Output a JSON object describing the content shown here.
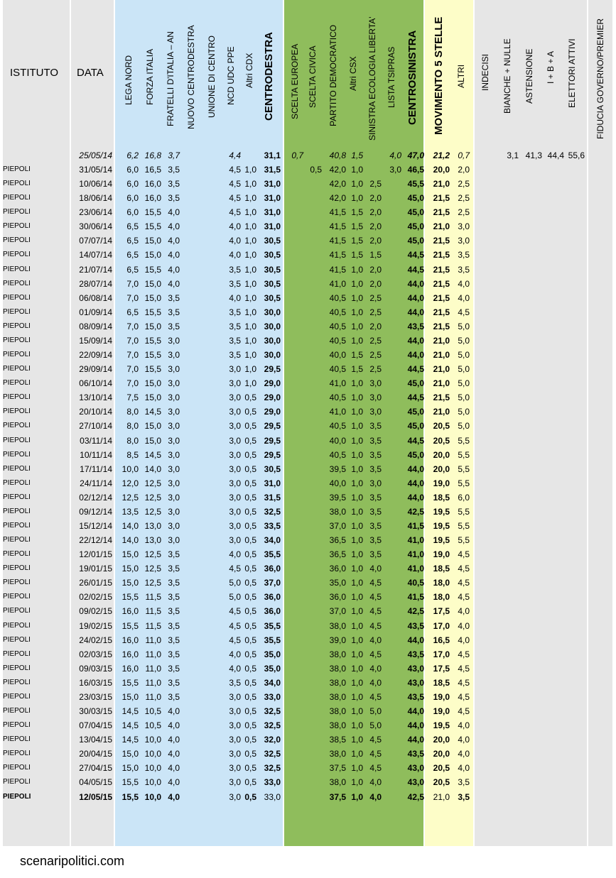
{
  "headers": {
    "istituto": "ISTITUTO",
    "data": "DATA",
    "lega_nord": "LEGA NORD",
    "forza_italia": "FORZA ITALIA",
    "fratelli_italia": "FRATELLI D'ITALIA – AN",
    "nuovo_cdx": "NUOVO  CENTRODESTRA",
    "unione_centro": "UNIONE DI CENTRO",
    "ncd_udc": "NCD UDC PPE",
    "altri_cdx": "Altri CDX",
    "centrodestra": "CENTRODESTRA",
    "scelta_europea": "SCELTA EUROPEA",
    "scelta_civica": "SCELTA CIVICA",
    "pd": "PARTITO DEMOCRATICO",
    "altri_csx": "Altri CSX",
    "sel": "SINISTRA ECOLOGIA LIBERTA'",
    "tsipras": "LISTA TSIPRAS",
    "centrosinistra": "CENTROSINISTRA",
    "m5s": "MOVIMENTO 5 STELLE",
    "altri": "ALTRI",
    "indecisi": "INDECISI",
    "bianche": "BIANCHE + NULLE",
    "astensione": "ASTENSIONE",
    "ibia": "I + B + A",
    "elettori": "ELETTORI ATTIVI",
    "fiducia": "FIDUCIA GOVERNO/PREMIER"
  },
  "colors": {
    "gray": "#e6e6e6",
    "blue": "#cbe5f7",
    "green": "#8fbd5c",
    "yellow": "#fdfdc8",
    "white": "#ffffff"
  },
  "first_row": {
    "data": "25/05/14",
    "ln": "6,2",
    "fi": "16,8",
    "fdi": "3,7",
    "ncd": "4,4",
    "cdx": "31,1",
    "se": "0,7",
    "pd": "40,8",
    "acsx": "1,5",
    "tsi": "4,0",
    "csx": "47,0",
    "m5s": "21,2",
    "altri": "0,7",
    "bian": "3,1",
    "ast": "41,3",
    "iba": "44,4",
    "el": "55,6"
  },
  "rows": [
    {
      "ist": "PIEPOLI",
      "data": "31/05/14",
      "ln": "6,0",
      "fi": "16,5",
      "fdi": "3,5",
      "ncd": "4,5",
      "acdx": "1,0",
      "cdx": "31,5",
      "sc": "0,5",
      "pd": "42,0",
      "acsx": "1,0",
      "sel": "",
      "tsi": "3,0",
      "csx": "46,5",
      "m5s": "20,0",
      "altri": "2,0"
    },
    {
      "ist": "PIEPOLI",
      "data": "10/06/14",
      "ln": "6,0",
      "fi": "16,0",
      "fdi": "3,5",
      "ncd": "4,5",
      "acdx": "1,0",
      "cdx": "31,0",
      "pd": "42,0",
      "acsx": "1,0",
      "sel": "2,5",
      "csx": "45,5",
      "m5s": "21,0",
      "altri": "2,5"
    },
    {
      "ist": "PIEPOLI",
      "data": "18/06/14",
      "ln": "6,0",
      "fi": "16,0",
      "fdi": "3,5",
      "ncd": "4,5",
      "acdx": "1,0",
      "cdx": "31,0",
      "pd": "42,0",
      "acsx": "1,0",
      "sel": "2,0",
      "csx": "45,0",
      "m5s": "21,5",
      "altri": "2,5"
    },
    {
      "ist": "PIEPOLI",
      "data": "23/06/14",
      "ln": "6,0",
      "fi": "15,5",
      "fdi": "4,0",
      "ncd": "4,5",
      "acdx": "1,0",
      "cdx": "31,0",
      "pd": "41,5",
      "acsx": "1,5",
      "sel": "2,0",
      "csx": "45,0",
      "m5s": "21,5",
      "altri": "2,5"
    },
    {
      "ist": "PIEPOLI",
      "data": "30/06/14",
      "ln": "6,5",
      "fi": "15,5",
      "fdi": "4,0",
      "ncd": "4,0",
      "acdx": "1,0",
      "cdx": "31,0",
      "pd": "41,5",
      "acsx": "1,5",
      "sel": "2,0",
      "csx": "45,0",
      "m5s": "21,0",
      "altri": "3,0"
    },
    {
      "ist": "PIEPOLI",
      "data": "07/07/14",
      "ln": "6,5",
      "fi": "15,0",
      "fdi": "4,0",
      "ncd": "4,0",
      "acdx": "1,0",
      "cdx": "30,5",
      "pd": "41,5",
      "acsx": "1,5",
      "sel": "2,0",
      "csx": "45,0",
      "m5s": "21,5",
      "altri": "3,0"
    },
    {
      "ist": "PIEPOLI",
      "data": "14/07/14",
      "ln": "6,5",
      "fi": "15,0",
      "fdi": "4,0",
      "ncd": "4,0",
      "acdx": "1,0",
      "cdx": "30,5",
      "pd": "41,5",
      "acsx": "1,5",
      "sel": "1,5",
      "csx": "44,5",
      "m5s": "21,5",
      "altri": "3,5"
    },
    {
      "ist": "PIEPOLI",
      "data": "21/07/14",
      "ln": "6,5",
      "fi": "15,5",
      "fdi": "4,0",
      "ncd": "3,5",
      "acdx": "1,0",
      "cdx": "30,5",
      "pd": "41,5",
      "acsx": "1,0",
      "sel": "2,0",
      "csx": "44,5",
      "m5s": "21,5",
      "altri": "3,5"
    },
    {
      "ist": "PIEPOLI",
      "data": "28/07/14",
      "ln": "7,0",
      "fi": "15,0",
      "fdi": "4,0",
      "ncd": "3,5",
      "acdx": "1,0",
      "cdx": "30,5",
      "pd": "41,0",
      "acsx": "1,0",
      "sel": "2,0",
      "csx": "44,0",
      "m5s": "21,5",
      "altri": "4,0"
    },
    {
      "ist": "PIEPOLI",
      "data": "06/08/14",
      "ln": "7,0",
      "fi": "15,0",
      "fdi": "3,5",
      "ncd": "4,0",
      "acdx": "1,0",
      "cdx": "30,5",
      "pd": "40,5",
      "acsx": "1,0",
      "sel": "2,5",
      "csx": "44,0",
      "m5s": "21,5",
      "altri": "4,0"
    },
    {
      "ist": "PIEPOLI",
      "data": "01/09/14",
      "ln": "6,5",
      "fi": "15,5",
      "fdi": "3,5",
      "ncd": "3,5",
      "acdx": "1,0",
      "cdx": "30,0",
      "pd": "40,5",
      "acsx": "1,0",
      "sel": "2,5",
      "csx": "44,0",
      "m5s": "21,5",
      "altri": "4,5"
    },
    {
      "ist": "PIEPOLI",
      "data": "08/09/14",
      "ln": "7,0",
      "fi": "15,0",
      "fdi": "3,5",
      "ncd": "3,5",
      "acdx": "1,0",
      "cdx": "30,0",
      "pd": "40,5",
      "acsx": "1,0",
      "sel": "2,0",
      "csx": "43,5",
      "m5s": "21,5",
      "altri": "5,0"
    },
    {
      "ist": "PIEPOLI",
      "data": "15/09/14",
      "ln": "7,0",
      "fi": "15,5",
      "fdi": "3,0",
      "ncd": "3,5",
      "acdx": "1,0",
      "cdx": "30,0",
      "pd": "40,5",
      "acsx": "1,0",
      "sel": "2,5",
      "csx": "44,0",
      "m5s": "21,0",
      "altri": "5,0"
    },
    {
      "ist": "PIEPOLI",
      "data": "22/09/14",
      "ln": "7,0",
      "fi": "15,5",
      "fdi": "3,0",
      "ncd": "3,5",
      "acdx": "1,0",
      "cdx": "30,0",
      "pd": "40,0",
      "acsx": "1,5",
      "sel": "2,5",
      "csx": "44,0",
      "m5s": "21,0",
      "altri": "5,0"
    },
    {
      "ist": "PIEPOLI",
      "data": "29/09/14",
      "ln": "7,0",
      "fi": "15,5",
      "fdi": "3,0",
      "ncd": "3,0",
      "acdx": "1,0",
      "cdx": "29,5",
      "pd": "40,5",
      "acsx": "1,5",
      "sel": "2,5",
      "csx": "44,5",
      "m5s": "21,0",
      "altri": "5,0"
    },
    {
      "ist": "PIEPOLI",
      "data": "06/10/14",
      "ln": "7,0",
      "fi": "15,0",
      "fdi": "3,0",
      "ncd": "3,0",
      "acdx": "1,0",
      "cdx": "29,0",
      "pd": "41,0",
      "acsx": "1,0",
      "sel": "3,0",
      "csx": "45,0",
      "m5s": "21,0",
      "altri": "5,0"
    },
    {
      "ist": "PIEPOLI",
      "data": "13/10/14",
      "ln": "7,5",
      "fi": "15,0",
      "fdi": "3,0",
      "ncd": "3,0",
      "acdx": "0,5",
      "cdx": "29,0",
      "pd": "40,5",
      "acsx": "1,0",
      "sel": "3,0",
      "csx": "44,5",
      "m5s": "21,5",
      "altri": "5,0"
    },
    {
      "ist": "PIEPOLI",
      "data": "20/10/14",
      "ln": "8,0",
      "fi": "14,5",
      "fdi": "3,0",
      "ncd": "3,0",
      "acdx": "0,5",
      "cdx": "29,0",
      "pd": "41,0",
      "acsx": "1,0",
      "sel": "3,0",
      "csx": "45,0",
      "m5s": "21,0",
      "altri": "5,0"
    },
    {
      "ist": "PIEPOLI",
      "data": "27/10/14",
      "ln": "8,0",
      "fi": "15,0",
      "fdi": "3,0",
      "ncd": "3,0",
      "acdx": "0,5",
      "cdx": "29,5",
      "pd": "40,5",
      "acsx": "1,0",
      "sel": "3,5",
      "csx": "45,0",
      "m5s": "20,5",
      "altri": "5,0"
    },
    {
      "ist": "PIEPOLI",
      "data": "03/11/14",
      "ln": "8,0",
      "fi": "15,0",
      "fdi": "3,0",
      "ncd": "3,0",
      "acdx": "0,5",
      "cdx": "29,5",
      "pd": "40,0",
      "acsx": "1,0",
      "sel": "3,5",
      "csx": "44,5",
      "m5s": "20,5",
      "altri": "5,5"
    },
    {
      "ist": "PIEPOLI",
      "data": "10/11/14",
      "ln": "8,5",
      "fi": "14,5",
      "fdi": "3,0",
      "ncd": "3,0",
      "acdx": "0,5",
      "cdx": "29,5",
      "pd": "40,5",
      "acsx": "1,0",
      "sel": "3,5",
      "csx": "45,0",
      "m5s": "20,0",
      "altri": "5,5"
    },
    {
      "ist": "PIEPOLI",
      "data": "17/11/14",
      "ln": "10,0",
      "fi": "14,0",
      "fdi": "3,0",
      "ncd": "3,0",
      "acdx": "0,5",
      "cdx": "30,5",
      "pd": "39,5",
      "acsx": "1,0",
      "sel": "3,5",
      "csx": "44,0",
      "m5s": "20,0",
      "altri": "5,5"
    },
    {
      "ist": "PIEPOLI",
      "data": "24/11/14",
      "ln": "12,0",
      "fi": "12,5",
      "fdi": "3,0",
      "ncd": "3,0",
      "acdx": "0,5",
      "cdx": "31,0",
      "pd": "40,0",
      "acsx": "1,0",
      "sel": "3,0",
      "csx": "44,0",
      "m5s": "19,0",
      "altri": "5,5"
    },
    {
      "ist": "PIEPOLI",
      "data": "02/12/14",
      "ln": "12,5",
      "fi": "12,5",
      "fdi": "3,0",
      "ncd": "3,0",
      "acdx": "0,5",
      "cdx": "31,5",
      "pd": "39,5",
      "acsx": "1,0",
      "sel": "3,5",
      "csx": "44,0",
      "m5s": "18,5",
      "altri": "6,0"
    },
    {
      "ist": "PIEPOLI",
      "data": "09/12/14",
      "ln": "13,5",
      "fi": "12,5",
      "fdi": "3,0",
      "ncd": "3,0",
      "acdx": "0,5",
      "cdx": "32,5",
      "pd": "38,0",
      "acsx": "1,0",
      "sel": "3,5",
      "csx": "42,5",
      "m5s": "19,5",
      "altri": "5,5"
    },
    {
      "ist": "PIEPOLI",
      "data": "15/12/14",
      "ln": "14,0",
      "fi": "13,0",
      "fdi": "3,0",
      "ncd": "3,0",
      "acdx": "0,5",
      "cdx": "33,5",
      "pd": "37,0",
      "acsx": "1,0",
      "sel": "3,5",
      "csx": "41,5",
      "m5s": "19,5",
      "altri": "5,5"
    },
    {
      "ist": "PIEPOLI",
      "data": "22/12/14",
      "ln": "14,0",
      "fi": "13,0",
      "fdi": "3,0",
      "ncd": "3,0",
      "acdx": "0,5",
      "cdx": "34,0",
      "pd": "36,5",
      "acsx": "1,0",
      "sel": "3,5",
      "csx": "41,0",
      "m5s": "19,5",
      "altri": "5,5"
    },
    {
      "ist": "PIEPOLI",
      "data": "12/01/15",
      "ln": "15,0",
      "fi": "12,5",
      "fdi": "3,5",
      "ncd": "4,0",
      "acdx": "0,5",
      "cdx": "35,5",
      "pd": "36,5",
      "acsx": "1,0",
      "sel": "3,5",
      "csx": "41,0",
      "m5s": "19,0",
      "altri": "4,5"
    },
    {
      "ist": "PIEPOLI",
      "data": "19/01/15",
      "ln": "15,0",
      "fi": "12,5",
      "fdi": "3,5",
      "ncd": "4,5",
      "acdx": "0,5",
      "cdx": "36,0",
      "pd": "36,0",
      "acsx": "1,0",
      "sel": "4,0",
      "csx": "41,0",
      "m5s": "18,5",
      "altri": "4,5"
    },
    {
      "ist": "PIEPOLI",
      "data": "26/01/15",
      "ln": "15,0",
      "fi": "12,5",
      "fdi": "3,5",
      "ncd": "5,0",
      "acdx": "0,5",
      "cdx": "37,0",
      "pd": "35,0",
      "acsx": "1,0",
      "sel": "4,5",
      "csx": "40,5",
      "m5s": "18,0",
      "altri": "4,5"
    },
    {
      "ist": "PIEPOLI",
      "data": "02/02/15",
      "ln": "15,5",
      "fi": "11,5",
      "fdi": "3,5",
      "ncd": "5,0",
      "acdx": "0,5",
      "cdx": "36,0",
      "pd": "36,0",
      "acsx": "1,0",
      "sel": "4,5",
      "csx": "41,5",
      "m5s": "18,0",
      "altri": "4,5"
    },
    {
      "ist": "PIEPOLI",
      "data": "09/02/15",
      "ln": "16,0",
      "fi": "11,5",
      "fdi": "3,5",
      "ncd": "4,5",
      "acdx": "0,5",
      "cdx": "36,0",
      "pd": "37,0",
      "acsx": "1,0",
      "sel": "4,5",
      "csx": "42,5",
      "m5s": "17,5",
      "altri": "4,0"
    },
    {
      "ist": "PIEPOLI",
      "data": "19/02/15",
      "ln": "15,5",
      "fi": "11,5",
      "fdi": "3,5",
      "ncd": "4,5",
      "acdx": "0,5",
      "cdx": "35,5",
      "pd": "38,0",
      "acsx": "1,0",
      "sel": "4,5",
      "csx": "43,5",
      "m5s": "17,0",
      "altri": "4,0"
    },
    {
      "ist": "PIEPOLI",
      "data": "24/02/15",
      "ln": "16,0",
      "fi": "11,0",
      "fdi": "3,5",
      "ncd": "4,5",
      "acdx": "0,5",
      "cdx": "35,5",
      "pd": "39,0",
      "acsx": "1,0",
      "sel": "4,0",
      "csx": "44,0",
      "m5s": "16,5",
      "altri": "4,0"
    },
    {
      "ist": "PIEPOLI",
      "data": "02/03/15",
      "ln": "16,0",
      "fi": "11,0",
      "fdi": "3,5",
      "ncd": "4,0",
      "acdx": "0,5",
      "cdx": "35,0",
      "pd": "38,0",
      "acsx": "1,0",
      "sel": "4,5",
      "csx": "43,5",
      "m5s": "17,0",
      "altri": "4,5"
    },
    {
      "ist": "PIEPOLI",
      "data": "09/03/15",
      "ln": "16,0",
      "fi": "11,0",
      "fdi": "3,5",
      "ncd": "4,0",
      "acdx": "0,5",
      "cdx": "35,0",
      "pd": "38,0",
      "acsx": "1,0",
      "sel": "4,0",
      "csx": "43,0",
      "m5s": "17,5",
      "altri": "4,5"
    },
    {
      "ist": "PIEPOLI",
      "data": "16/03/15",
      "ln": "15,5",
      "fi": "11,0",
      "fdi": "3,5",
      "ncd": "3,5",
      "acdx": "0,5",
      "cdx": "34,0",
      "pd": "38,0",
      "acsx": "1,0",
      "sel": "4,0",
      "csx": "43,0",
      "m5s": "18,5",
      "altri": "4,5"
    },
    {
      "ist": "PIEPOLI",
      "data": "23/03/15",
      "ln": "15,0",
      "fi": "11,0",
      "fdi": "3,5",
      "ncd": "3,0",
      "acdx": "0,5",
      "cdx": "33,0",
      "pd": "38,0",
      "acsx": "1,0",
      "sel": "4,5",
      "csx": "43,5",
      "m5s": "19,0",
      "altri": "4,5"
    },
    {
      "ist": "PIEPOLI",
      "data": "30/03/15",
      "ln": "14,5",
      "fi": "10,5",
      "fdi": "4,0",
      "ncd": "3,0",
      "acdx": "0,5",
      "cdx": "32,5",
      "pd": "38,0",
      "acsx": "1,0",
      "sel": "5,0",
      "csx": "44,0",
      "m5s": "19,0",
      "altri": "4,5"
    },
    {
      "ist": "PIEPOLI",
      "data": "07/04/15",
      "ln": "14,5",
      "fi": "10,5",
      "fdi": "4,0",
      "ncd": "3,0",
      "acdx": "0,5",
      "cdx": "32,5",
      "pd": "38,0",
      "acsx": "1,0",
      "sel": "5,0",
      "csx": "44,0",
      "m5s": "19,5",
      "altri": "4,0"
    },
    {
      "ist": "PIEPOLI",
      "data": "13/04/15",
      "ln": "14,5",
      "fi": "10,0",
      "fdi": "4,0",
      "ncd": "3,0",
      "acdx": "0,5",
      "cdx": "32,0",
      "pd": "38,5",
      "acsx": "1,0",
      "sel": "4,5",
      "csx": "44,0",
      "m5s": "20,0",
      "altri": "4,0"
    },
    {
      "ist": "PIEPOLI",
      "data": "20/04/15",
      "ln": "15,0",
      "fi": "10,0",
      "fdi": "4,0",
      "ncd": "3,0",
      "acdx": "0,5",
      "cdx": "32,5",
      "pd": "38,0",
      "acsx": "1,0",
      "sel": "4,5",
      "csx": "43,5",
      "m5s": "20,0",
      "altri": "4,0"
    },
    {
      "ist": "PIEPOLI",
      "data": "27/04/15",
      "ln": "15,0",
      "fi": "10,0",
      "fdi": "4,0",
      "ncd": "3,0",
      "acdx": "0,5",
      "cdx": "32,5",
      "pd": "37,5",
      "acsx": "1,0",
      "sel": "4,5",
      "csx": "43,0",
      "m5s": "20,5",
      "altri": "4,0"
    },
    {
      "ist": "PIEPOLI",
      "data": "04/05/15",
      "ln": "15,5",
      "fi": "10,0",
      "fdi": "4,0",
      "ncd": "3,0",
      "acdx": "0,5",
      "cdx": "33,0",
      "pd": "38,0",
      "acsx": "1,0",
      "sel": "4,0",
      "csx": "43,0",
      "m5s": "20,5",
      "altri": "3,5"
    },
    {
      "ist": "PIEPOLI",
      "data": "12/05/15",
      "ln": "15,5",
      "fi": "10,0",
      "fdi": "4,0",
      "ncd": "3,0",
      "acdx": "0,5",
      "cdx": "33,0",
      "pd": "37,5",
      "acsx": "1,0",
      "sel": "4,0",
      "csx": "42,5",
      "m5s": "21,0",
      "altri": "3,5",
      "bold": true
    }
  ],
  "footer": "scenaripolitici.com"
}
